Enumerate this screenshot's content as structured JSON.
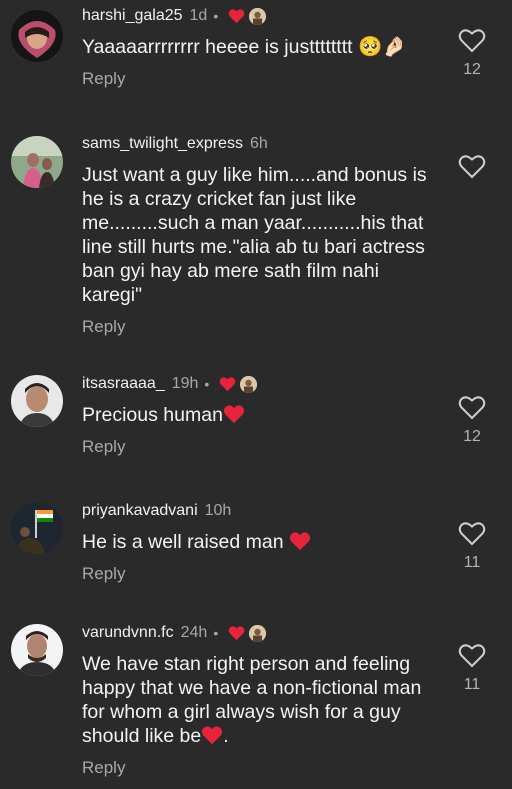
{
  "comments": [
    {
      "username": "harshi_gala25",
      "time": "1d",
      "text": "Yaaaaarrrrrrrr heeee is justttttttt 🥺🤌🏻",
      "reply_label": "Reply",
      "like_count": "12",
      "creator_liked": true
    },
    {
      "username": "sams_twilight_express",
      "time": "6h",
      "text": "Just want a guy like him.....and bonus is he is a crazy cricket fan just like me.........such a man yaar...........his that line still hurts me.\"alia ab tu bari actress ban gyi hay ab mere sath film nahi karegi\"",
      "reply_label": "Reply",
      "like_count": "",
      "creator_liked": false
    },
    {
      "username": "itsasraaaa_",
      "time": "19h",
      "text": "Precious human",
      "reply_label": "Reply",
      "like_count": "12",
      "creator_liked": true
    },
    {
      "username": "priyankavadvani",
      "time": "10h",
      "text": "He is a well raised man",
      "reply_label": "Reply",
      "like_count": "11",
      "creator_liked": false
    },
    {
      "username": "varundvnn.fc",
      "time": "24h",
      "text": "We have stan right person and feeling happy that we have a non-fictional man for whom a girl always wish for a guy should like be",
      "text_end": ".",
      "reply_label": "Reply",
      "like_count": "11",
      "creator_liked": true
    }
  ],
  "colors": {
    "background": "#2a2a2b",
    "heart_red": "#e8243c",
    "meta_gray": "#a8a8a8"
  }
}
